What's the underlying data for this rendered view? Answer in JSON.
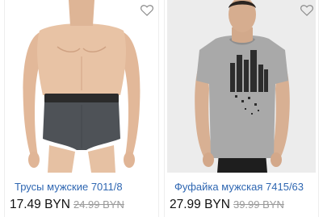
{
  "products": [
    {
      "title": "Трусы мужские 7011/8",
      "price": "17.49 BYN",
      "old_price": "24.99 BYN",
      "favorite_icon": "heart-outline-icon",
      "image": "man-in-gray-boxer-briefs-photo"
    },
    {
      "title": "Фуфайка мужская 7415/63",
      "price": "27.99 BYN",
      "old_price": "39.99 BYN",
      "favorite_icon": "heart-outline-icon",
      "image": "man-in-gray-printed-tshirt-photo"
    }
  ],
  "colors": {
    "title_link": "#2f67b2",
    "price": "#111111",
    "old_price": "#9a9a9a",
    "icon": "#8a8a8a"
  }
}
